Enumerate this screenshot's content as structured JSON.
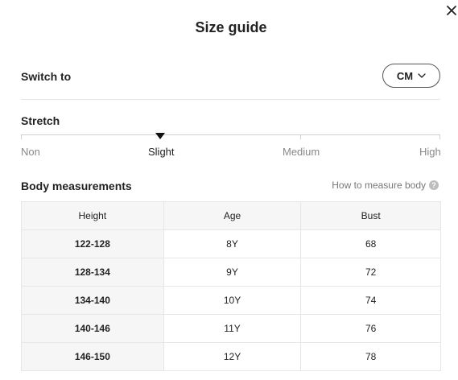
{
  "dialog": {
    "title": "Size guide",
    "close_icon": "close-icon"
  },
  "unit_switch": {
    "label": "Switch to",
    "selected": "CM",
    "icon": "chevron-down-icon"
  },
  "stretch": {
    "label": "Stretch",
    "options": [
      "Non",
      "Slight",
      "Medium",
      "High"
    ],
    "selected": "Slight"
  },
  "body_measurements": {
    "label": "Body measurements",
    "help_link": "How to measure body",
    "help_icon": "question-circle-icon",
    "columns": [
      "Height",
      "Age",
      "Bust"
    ],
    "rows": [
      [
        "122-128",
        "8Y",
        "68"
      ],
      [
        "128-134",
        "9Y",
        "72"
      ],
      [
        "134-140",
        "10Y",
        "74"
      ],
      [
        "140-146",
        "11Y",
        "76"
      ],
      [
        "146-150",
        "12Y",
        "78"
      ]
    ]
  }
}
